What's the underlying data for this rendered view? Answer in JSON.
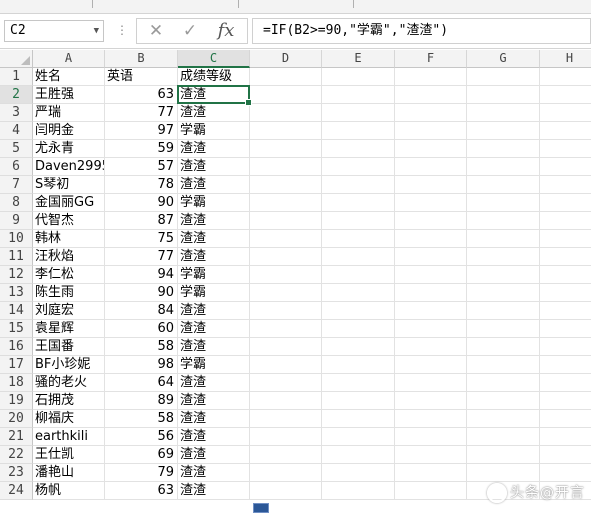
{
  "name_box": {
    "value": "C2",
    "dropdown_icon": "chevron-down-icon"
  },
  "formula_bar": {
    "cancel_icon": "cancel-x-icon",
    "enter_icon": "check-icon",
    "function_label": "fx",
    "formula": "=IF(B2>=90,\"学霸\",\"渣渣\")"
  },
  "columns": [
    "A",
    "B",
    "C",
    "D",
    "E",
    "F",
    "G",
    "H"
  ],
  "selected_cell": "C2",
  "rows": [
    {
      "row": "1",
      "name": "姓名",
      "english": "英语",
      "grade": "成绩等级"
    },
    {
      "row": "2",
      "name": "王胜强",
      "english": "63",
      "grade": "渣渣"
    },
    {
      "row": "3",
      "name": "严瑞",
      "english": "77",
      "grade": "渣渣"
    },
    {
      "row": "4",
      "name": "闫明金",
      "english": "97",
      "grade": "学霸"
    },
    {
      "row": "5",
      "name": "尤永青",
      "english": "59",
      "grade": "渣渣"
    },
    {
      "row": "6",
      "name": "Daven2995",
      "english": "57",
      "grade": "渣渣"
    },
    {
      "row": "7",
      "name": "S琴初",
      "english": "78",
      "grade": "渣渣"
    },
    {
      "row": "8",
      "name": "金国丽GG",
      "english": "90",
      "grade": "学霸"
    },
    {
      "row": "9",
      "name": "代智杰",
      "english": "87",
      "grade": "渣渣"
    },
    {
      "row": "10",
      "name": "韩林",
      "english": "75",
      "grade": "渣渣"
    },
    {
      "row": "11",
      "name": "汪秋焰",
      "english": "77",
      "grade": "渣渣"
    },
    {
      "row": "12",
      "name": "李仁松",
      "english": "94",
      "grade": "学霸"
    },
    {
      "row": "13",
      "name": "陈生雨",
      "english": "90",
      "grade": "学霸"
    },
    {
      "row": "14",
      "name": "刘庭宏",
      "english": "84",
      "grade": "渣渣"
    },
    {
      "row": "15",
      "name": "袁星辉",
      "english": "60",
      "grade": "渣渣"
    },
    {
      "row": "16",
      "name": "王国番",
      "english": "58",
      "grade": "渣渣"
    },
    {
      "row": "17",
      "name": "BF小珍妮",
      "english": "98",
      "grade": "学霸"
    },
    {
      "row": "18",
      "name": "骚的老火",
      "english": "64",
      "grade": "渣渣"
    },
    {
      "row": "19",
      "name": "石拥茂",
      "english": "89",
      "grade": "渣渣"
    },
    {
      "row": "20",
      "name": "柳福庆",
      "english": "58",
      "grade": "渣渣"
    },
    {
      "row": "21",
      "name": "earthkili",
      "english": "56",
      "grade": "渣渣"
    },
    {
      "row": "22",
      "name": "王仕凯",
      "english": "69",
      "grade": "渣渣"
    },
    {
      "row": "23",
      "name": "潘艳山",
      "english": "79",
      "grade": "渣渣"
    },
    {
      "row": "24",
      "name": "杨帆",
      "english": "63",
      "grade": "渣渣"
    }
  ],
  "watermark": {
    "text": "头条@开言",
    "icon": "toutiao-logo-icon"
  },
  "colors": {
    "selection": "#217346",
    "header_bg": "#f3f3f3",
    "paste_options": "#2b5797"
  }
}
